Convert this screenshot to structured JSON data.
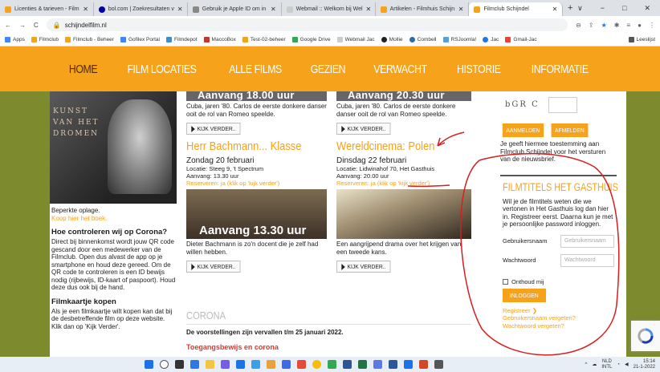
{
  "browser": {
    "tabs": [
      {
        "label": "Licenties & tarieven - Film",
        "color": "#f7a21b"
      },
      {
        "label": "bol.com | Zoekresultaten v",
        "color": "#0000a4"
      },
      {
        "label": "Gebruik je Apple ID om in",
        "color": "#888888"
      },
      {
        "label": "Webmail :: Welkom bij Wel",
        "color": "#cccccc"
      },
      {
        "label": "Artikelen - Filmhuis Schijn",
        "color": "#f7a21b"
      },
      {
        "label": "Filmclub Schijndel",
        "color": "#f7a21b",
        "active": true
      }
    ],
    "new_tab": "+",
    "window_controls": [
      "∨",
      "−",
      "□",
      "✕"
    ],
    "url": "schijndelfilm.nl",
    "bookmarks": [
      {
        "label": "Apps",
        "color": "#4285f4"
      },
      {
        "label": "Filmclub",
        "color": "#f7a21b"
      },
      {
        "label": "Filmclub - Beheer",
        "color": "#f7a21b"
      },
      {
        "label": "Gofilex Portal",
        "color": "#4285f4"
      },
      {
        "label": "Filmdepot",
        "color": "#3b8ed0"
      },
      {
        "label": "MaccoBox",
        "color": "#c0392b"
      },
      {
        "label": "Test-02-beheer",
        "color": "#f7a21b"
      },
      {
        "label": "Google Drive",
        "color": "#34a853"
      },
      {
        "label": "Webmail Jac",
        "color": "#cccccc"
      },
      {
        "label": "Mollie",
        "color": "#222222"
      },
      {
        "label": "Combell",
        "color": "#2b6cb0"
      },
      {
        "label": "RSJoomla!",
        "color": "#5aa0d8"
      },
      {
        "label": "Jac",
        "color": "#1877f2"
      },
      {
        "label": "Gmail-Jac",
        "color": "#ea4335"
      },
      {
        "label": "Leeslijst",
        "color": "#555555"
      }
    ]
  },
  "nav": [
    "HOME",
    "FILM LOCATIES",
    "ALLE FILMS",
    "GEZIEN",
    "VERWACHT",
    "HISTORIE",
    "INFORMATIE"
  ],
  "sidebar": {
    "book_title_lines": [
      "KUNST",
      "VAN HET",
      "DROMEN"
    ],
    "book_caption": "Beperkte oplage.",
    "book_link": "Koop hier het boek.",
    "corona_heading": "Hoe controleren wij op Corona?",
    "corona_text": "Direct bij binnenkomst wordt jouw QR code gescand door een medewerker van de Filmclub. Open dus alvast de app op je smartphone en houd deze gereed. Om de QR code te controleren is een ID bewijs nodig (rijbewijs, ID-kaart of paspoort). Houd deze dus ook bij de hand.",
    "ticket_heading": "Filmkaartje kopen",
    "ticket_text": "Als je een filmkaartje wilt kopen kan dat bij de desbetreffende film op deze website. Klik dan op 'Kijk Verder'."
  },
  "films": [
    {
      "strip": "Aanvang 18.00 uur",
      "desc": "Cuba, jaren '80. Carlos de eerste donkere danser ooit de rol van Romeo speelde.",
      "button": "KIJK VERDER..",
      "title": "Herr Bachmann... Klasse",
      "date": "Zondag 20 februari",
      "location": "Locatie: Steeg 9, 't Spectrum",
      "start": "Aanvang: 13.30 uur",
      "reserve": "Reserveren: ja (klik op 'kijk verder')",
      "overlay": "Aanvang 13.30 uur",
      "desc2": "Dieter Bachmann is zo'n docent die je zelf had willen hebben.",
      "button2": "KIJK VERDER.."
    },
    {
      "strip": "Aanvang 20.30 uur",
      "desc": "Cuba, jaren '80. Carlos de eerste donkere danser ooit de rol van Romeo speelde.",
      "button": "KIJK VERDER..",
      "title": "Wereldcinema: Polen",
      "date": "Dinsdag 22 februari",
      "location": "Locatie: Lidwinahof 70, Het Gasthuis",
      "start": "Aanvang: 20.00 uur",
      "reserve": "Reserveren: ja (klik op 'kijk verder')",
      "overlay": "",
      "desc2": "Een aangrijpend drama over het krijgen van een tweede kans.",
      "button2": "KIJK VERDER.."
    }
  ],
  "corona": {
    "heading": "CORONA",
    "text": "De voorstellingen zijn vervallen t/m 25 januari 2022.",
    "link": "Toegangsbewijs en corona"
  },
  "login": {
    "captcha": "bGR C",
    "register_btn": "AANMELDEN",
    "unsubscribe_btn": "AFMELDEN",
    "consent": "Je geeft hiermee toestemming aan Filmclub Schijndel voor het versturen van de nieuwsbrief.",
    "box_title": "FILMTITELS HET GASTHUIS",
    "box_text": "Wil je de filmtitels weten die we vertonen in Het Gasthuis log dan hier in. Registreer eerst. Daarna kun je met je persoonlijke password inloggen.",
    "username_label": "Gebruikersnaam",
    "username_placeholder": "Gebruikersnaam",
    "password_label": "Wachtwoord",
    "password_placeholder": "Wachtwoord",
    "remember": "Onthoud mij",
    "login_btn": "INLOGGEN",
    "register_link": "Registreer",
    "forgot_user": "Gebruikersnaam vergeten?",
    "forgot_pass": "Wachtwoord vergeten?"
  },
  "taskbar": {
    "tray_lang": "NLD",
    "tray_sub": "INTL",
    "time": "15:14",
    "date": "21-1-2022"
  }
}
